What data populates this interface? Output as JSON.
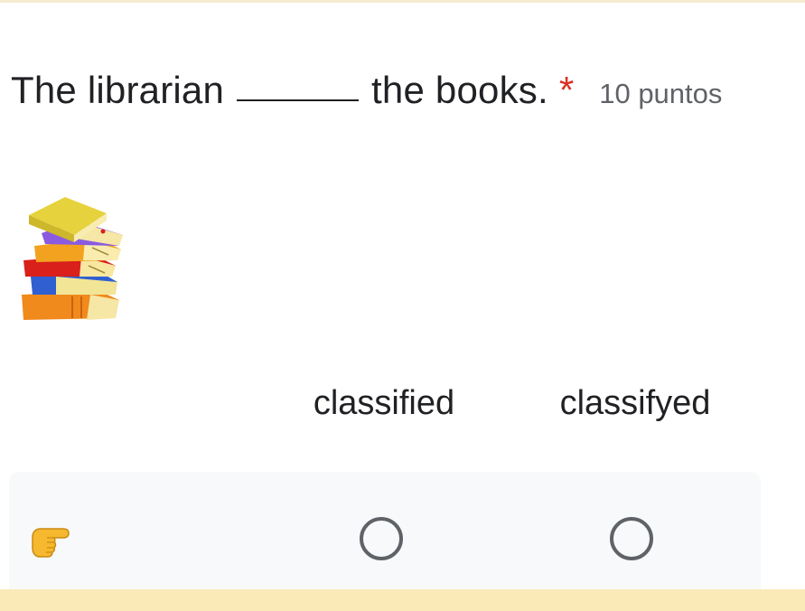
{
  "question": {
    "text_before": "The librarian",
    "text_after": "the books.",
    "required_marker": "*",
    "points": "10 puntos"
  },
  "image": {
    "icon": "books-stack-icon"
  },
  "grid": {
    "columns": [
      "classified",
      "classifyed"
    ],
    "rows": [
      {
        "label_icon": "backhand-index-pointing-right-icon",
        "selected": null
      }
    ]
  },
  "colors": {
    "required": "#d93025",
    "radio_border": "#5f6368",
    "row_background": "#f8f9fa",
    "bottom_band": "#faeab7"
  }
}
